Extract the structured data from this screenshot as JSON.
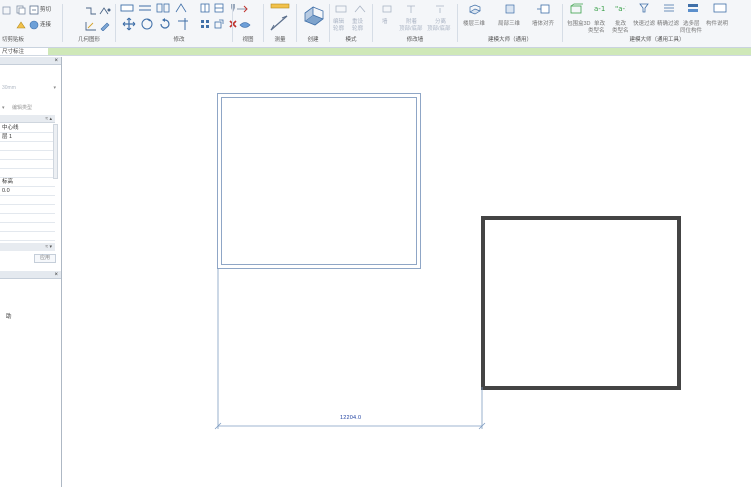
{
  "ribbon": {
    "groups": [
      {
        "label": "切剪贴板"
      },
      {
        "label": "几何图形"
      },
      {
        "label": "修改"
      },
      {
        "label": "视图"
      },
      {
        "label": "测量"
      },
      {
        "label": "创建"
      },
      {
        "label": "模式"
      },
      {
        "label": "修改墙"
      },
      {
        "label": "建模大师（通用）"
      },
      {
        "label": "建模大师（通用工具）"
      }
    ],
    "tools": {
      "cut": "剪切",
      "join": "连接",
      "mode_1": "编辑",
      "mode_2": "重设",
      "mode_3": "轮廓",
      "mode_4": "轮廓",
      "wall_1": "墙",
      "wall_2": "附着",
      "wall_3": "分离",
      "wall_4": "顶部/底部",
      "wall_5": "顶部/底部",
      "bm_1": "楼层三维",
      "bm_2": "局部三维",
      "bm_3": "墙体对齐",
      "bt_1": "包围盒3D",
      "bt_2": "单改",
      "bt_3": "批改",
      "bt_4": "快速过滤",
      "bt_5": "精确过滤",
      "bt_6": "选多层",
      "bt_7": "构件说明",
      "bt_8": "类型名",
      "bt_9": "类型名",
      "bt_10": "同位构件"
    }
  },
  "subrow": {
    "label": "尺寸标注"
  },
  "left_panel": {
    "placeholder": "30mm",
    "edit_type": "编辑类型",
    "rows": [
      "中心线",
      "层 1",
      "",
      "",
      "",
      "",
      "标高",
      "0.0",
      "",
      "",
      "",
      "",
      ""
    ],
    "apply": "应用",
    "section2_item": "助"
  },
  "canvas": {
    "dimension_text": "12204.0"
  },
  "colors": {
    "wall_outline": "#8fa6c6",
    "dimension_line": "#7f9dc2",
    "selected_wall": "#444444",
    "ribbon_bg": "#f4f6f9",
    "subrow_accent": "#cfe8b8"
  }
}
